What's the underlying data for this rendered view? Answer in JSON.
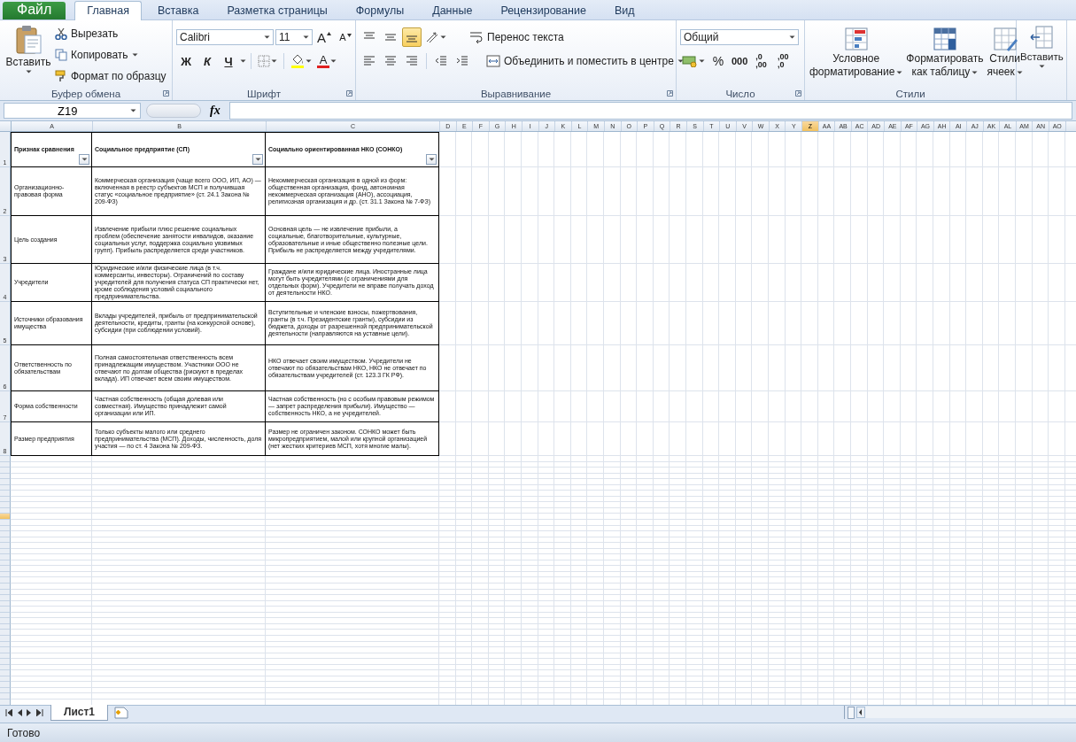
{
  "menu_tabs": [
    {
      "label": "Файл",
      "kind": "file",
      "selected": false
    },
    {
      "label": "Главная",
      "kind": "tab",
      "selected": true
    },
    {
      "label": "Вставка",
      "kind": "tab",
      "selected": false
    },
    {
      "label": "Разметка страницы",
      "kind": "tab",
      "selected": false
    },
    {
      "label": "Формулы",
      "kind": "tab",
      "selected": false
    },
    {
      "label": "Данные",
      "kind": "tab",
      "selected": false
    },
    {
      "label": "Рецензирование",
      "kind": "tab",
      "selected": false
    },
    {
      "label": "Вид",
      "kind": "tab",
      "selected": false
    }
  ],
  "ribbon": {
    "clipboard": {
      "label": "Буфер обмена",
      "paste": "Вставить",
      "cut": "Вырезать",
      "copy": "Копировать",
      "format_painter": "Формат по образцу"
    },
    "font": {
      "label": "Шрифт",
      "font_name": "Calibri",
      "font_size": "11",
      "grow": "A",
      "shrink": "A",
      "bold": "Ж",
      "italic": "К",
      "underline": "Ч",
      "font_color": "A"
    },
    "alignment": {
      "label": "Выравнивание",
      "vertical": [
        {
          "selected": false
        },
        {
          "selected": false
        },
        {
          "selected": true
        }
      ],
      "horizontal": [
        {
          "selected": false
        },
        {
          "selected": false
        },
        {
          "selected": false
        }
      ],
      "wrap_text": "Перенос текста",
      "merge": "Объединить и поместить в центре"
    },
    "number": {
      "label": "Число",
      "format": "Общий",
      "percent": "%",
      "thousands": "000",
      "decimal_buttons": [
        {
          "lines": [
            ",0",
            ",00"
          ]
        },
        {
          "lines": [
            ",00",
            ",0"
          ]
        }
      ]
    },
    "styles": {
      "label": "Стили",
      "buttons": [
        {
          "lines": [
            "Условное",
            "форматирование"
          ]
        },
        {
          "lines": [
            "Форматировать",
            "как таблицу"
          ]
        },
        {
          "lines": [
            "Стили",
            "ячеек"
          ]
        }
      ]
    },
    "cells": {
      "insert": "Вставить"
    }
  },
  "formula_bar": {
    "name_box": "Z19",
    "fx": "fx"
  },
  "columns": [
    {
      "label": "A",
      "selected": false
    },
    {
      "label": "B",
      "selected": false
    },
    {
      "label": "C",
      "selected": false
    },
    {
      "label": "D",
      "selected": false
    },
    {
      "label": "E",
      "selected": false
    },
    {
      "label": "F",
      "selected": false
    },
    {
      "label": "G",
      "selected": false
    },
    {
      "label": "H",
      "selected": false
    },
    {
      "label": "I",
      "selected": false
    },
    {
      "label": "J",
      "selected": false
    },
    {
      "label": "K",
      "selected": false
    },
    {
      "label": "L",
      "selected": false
    },
    {
      "label": "M",
      "selected": false
    },
    {
      "label": "N",
      "selected": false
    },
    {
      "label": "O",
      "selected": false
    },
    {
      "label": "P",
      "selected": false
    },
    {
      "label": "Q",
      "selected": false
    },
    {
      "label": "R",
      "selected": false
    },
    {
      "label": "S",
      "selected": false
    },
    {
      "label": "T",
      "selected": false
    },
    {
      "label": "U",
      "selected": false
    },
    {
      "label": "V",
      "selected": false
    },
    {
      "label": "W",
      "selected": false
    },
    {
      "label": "X",
      "selected": false
    },
    {
      "label": "Y",
      "selected": false
    },
    {
      "label": "Z",
      "selected": true
    },
    {
      "label": "AA",
      "selected": false
    },
    {
      "label": "AB",
      "selected": false
    },
    {
      "label": "AC",
      "selected": false
    },
    {
      "label": "AD",
      "selected": false
    },
    {
      "label": "AE",
      "selected": false
    },
    {
      "label": "AF",
      "selected": false
    },
    {
      "label": "AG",
      "selected": false
    },
    {
      "label": "AH",
      "selected": false
    },
    {
      "label": "AI",
      "selected": false
    },
    {
      "label": "AJ",
      "selected": false
    },
    {
      "label": "AK",
      "selected": false
    },
    {
      "label": "AL",
      "selected": false
    },
    {
      "label": "AM",
      "selected": false
    },
    {
      "label": "AN",
      "selected": false
    },
    {
      "label": "AO",
      "selected": false
    }
  ],
  "table_rows": [
    {
      "number": "1",
      "kind": "header",
      "selected": false,
      "cells": [
        "Признак сравнения",
        "Социальное предприятие (СП)",
        "Социально ориентированная НКО (СОНКО)"
      ]
    },
    {
      "number": "2",
      "kind": "data",
      "selected": false,
      "cells": [
        "Организационно-правовая форма",
        "Коммерческая организация (чаще всего ООО, ИП, АО) — включенная в реестр субъектов МСП и получившая статус «социальное предприятие» (ст. 24.1 Закона № 209-ФЗ)",
        "Некоммерческая организация в одной из форм: общественная организация, фонд, автономная некоммерческая организация (АНО), ассоциация, религиозная организация и др. (ст. 31.1 Закона № 7-ФЗ)"
      ]
    },
    {
      "number": "3",
      "kind": "data",
      "selected": false,
      "cells": [
        "Цель создания",
        "Извлечение прибыли плюс решение социальных проблем (обеспечение занятости инвалидов, оказание социальных услуг, поддержка социально уязвимых групп). Прибыль распределяется среди участников.",
        "Основная цель — не извлечение прибыли, а социальные, благотворительные, культурные, образовательные и иные общественно полезные цели. Прибыль не распределяется между учредителями."
      ]
    },
    {
      "number": "4",
      "kind": "data",
      "selected": false,
      "cells": [
        "Учредители",
        "Юридические и/или физические лица (в т.ч. коммерсанты, инвесторы). Ограничений по составу учредителей для получения статуса СП практически нет, кроме соблюдения условий социального предпринимательства.",
        "Граждане и/или юридические лица. Иностранные лица могут быть учредителями (с ограничениями для отдельных форм). Учредители не вправе получать доход от деятельности НКО."
      ]
    },
    {
      "number": "5",
      "kind": "data",
      "selected": false,
      "cells": [
        "Источники образования имущества",
        "Вклады учредителей, прибыль от предпринимательской деятельности, кредиты, гранты (на конкурсной основе), субсидии (при соблюдении условий).",
        "Вступительные и членские взносы, пожертвования, гранты (в т.ч. Президентские гранты), субсидии из бюджета, доходы от разрешенной предпринимательской деятельности (направляются на уставные цели)."
      ]
    },
    {
      "number": "6",
      "kind": "data",
      "selected": false,
      "cells": [
        "Ответственность по обязательствам",
        "Полная самостоятельная ответственность всем принадлежащим имуществом. Участники ООО не отвечают по долгам общества (рискуют в пределах вклада). ИП отвечает всем своим имуществом.",
        "НКО отвечает своим имуществом. Учредители не отвечают по обязательствам НКО, НКО не отвечает по обязательствам учредителей (ст. 123.3 ГК РФ)."
      ]
    },
    {
      "number": "7",
      "kind": "data",
      "selected": false,
      "cells": [
        "Форма собственности",
        "Частная собственность (общая долевая или совместная). Имущество принадлежит самой организации или ИП.",
        "Частная собственность (но с особым правовым режимом — запрет распределения прибыли). Имущество — собственность НКО, а не учредителей."
      ]
    },
    {
      "number": "8",
      "kind": "data",
      "selected": false,
      "cells": [
        "Размер предприятия",
        "Только субъекты малого или среднего предпринимательства (МСП). Доходы, численность, доля участия — по ст. 4 Закона № 209-ФЗ.",
        "Размер не ограничен законом. СОНКО может быть микропредприятием, малой или крупной организацией (нет жестких критериев МСП, хотя многие малы)."
      ]
    }
  ],
  "empty_rows": [
    {
      "selected": false
    },
    {
      "selected": false
    },
    {
      "selected": false
    },
    {
      "selected": false
    },
    {
      "selected": false
    },
    {
      "selected": false
    },
    {
      "selected": false
    },
    {
      "selected": false
    },
    {
      "selected": false
    },
    {
      "selected": false
    },
    {
      "selected": true
    },
    {
      "selected": false
    },
    {
      "selected": false
    },
    {
      "selected": false
    },
    {
      "selected": false
    },
    {
      "selected": false
    },
    {
      "selected": false
    },
    {
      "selected": false
    },
    {
      "selected": false
    },
    {
      "selected": false
    },
    {
      "selected": false
    },
    {
      "selected": false
    },
    {
      "selected": false
    },
    {
      "selected": false
    },
    {
      "selected": false
    },
    {
      "selected": false
    },
    {
      "selected": false
    },
    {
      "selected": false
    },
    {
      "selected": false
    },
    {
      "selected": false
    },
    {
      "selected": false
    },
    {
      "selected": false
    },
    {
      "selected": false
    },
    {
      "selected": false
    },
    {
      "selected": false
    },
    {
      "selected": false
    },
    {
      "selected": false
    },
    {
      "selected": false
    },
    {
      "selected": false
    },
    {
      "selected": false
    },
    {
      "selected": false
    },
    {
      "selected": false
    },
    {
      "selected": false
    }
  ],
  "sheet_tabs": [
    {
      "label": "Лист1",
      "selected": true
    }
  ],
  "status_bar": {
    "text": "Готово"
  }
}
